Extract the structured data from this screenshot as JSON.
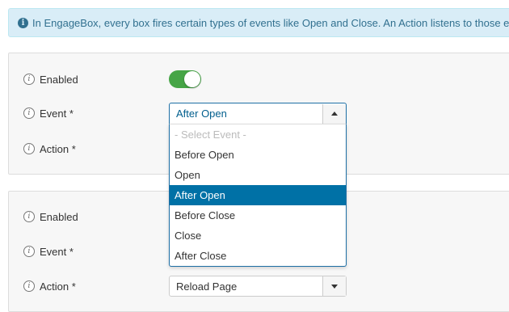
{
  "alert": {
    "text": "In EngageBox, every box fires certain types of events like Open and Close. An Action listens to those e"
  },
  "panel1": {
    "enabled_label": "Enabled",
    "enabled_state": "on",
    "event_label": "Event *",
    "event_value": "After Open",
    "action_label": "Action *"
  },
  "event_dropdown": {
    "options": [
      {
        "label": "- Select Event -",
        "placeholder": true
      },
      {
        "label": "Before Open"
      },
      {
        "label": "Open"
      },
      {
        "label": "After Open",
        "selected": true
      },
      {
        "label": "Before Close"
      },
      {
        "label": "Close"
      },
      {
        "label": "After Close"
      }
    ]
  },
  "panel2": {
    "enabled_label": "Enabled",
    "event_label": "Event *",
    "action_label": "Action *",
    "action_value": "Reload Page"
  },
  "colors": {
    "toggle_on": "#46a546",
    "selected_option": "#0071a6",
    "alert_bg": "#d9edf7"
  }
}
